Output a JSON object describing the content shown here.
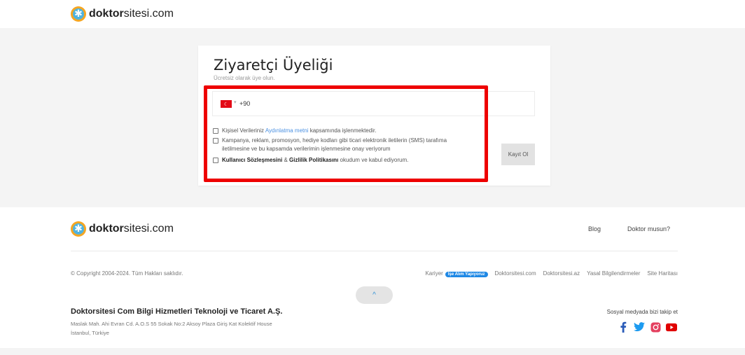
{
  "brand": {
    "bold": "doktor",
    "light": "sitesi.com"
  },
  "form": {
    "title": "Ziyaretçi Üyeliği",
    "subtitle": "Ücretsiz olarak üye olun.",
    "phone": {
      "flag": "☾",
      "dial_code": "+90"
    },
    "consents": [
      {
        "pre": "Kişisel Verileriniz ",
        "link": "Aydınlatma metni",
        "post": " kapsamında işlenmektedir."
      },
      {
        "line1": "Kampanya, reklam, promosyon, hediye kodları gibi ticari elektronik iletilerin (SMS) tarafıma",
        "line2": "iletilmesine ve bu kapsamda verilerimin işlenmesine onay veriyorum"
      },
      {
        "bold1": "Kullanıcı Sözleşmesini",
        "amp": " & ",
        "bold2": "Gizlilik Politikasını",
        "post": " okudum ve kabul ediyorum."
      }
    ],
    "register_label": "Kayıt Ol"
  },
  "footer": {
    "nav": {
      "blog": "Blog",
      "doctor": "Doktor musun?"
    },
    "copyright": "© Copyright 2004-2024. Tüm Hakları saklıdır.",
    "links": {
      "career": "Kariyer",
      "hiring_badge": "İşe Alım Yapıyoruz",
      "com": "Doktorsitesi.com",
      "az": "Doktorsitesi.az",
      "legal": "Yasal Bilgilendirmeler",
      "sitemap": "Site Haritası"
    },
    "scroll_top": "^",
    "company": {
      "name": "Doktorsitesi Com Bilgi Hizmetleri Teknoloji ve Ticaret A.Ş.",
      "address1": "Maslak Mah. Ahi Evran Cd. A.O.S 55 Sokak No:2 Aksoy Plaza Giriş Kat Kolektif House",
      "address2": "İstanbul, Türkiye"
    },
    "social": {
      "label": "Sosyal medyada bizi takip et",
      "icons": [
        "facebook-icon",
        "twitter-icon",
        "instagram-icon",
        "youtube-icon"
      ]
    }
  },
  "colors": {
    "highlight": "#ee0000",
    "link": "#4a90e2",
    "badge": "#1e88e5",
    "brand_orange": "#f5a623",
    "brand_blue": "#4fb3e0"
  }
}
